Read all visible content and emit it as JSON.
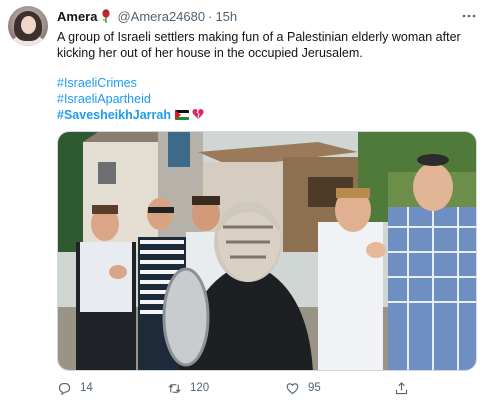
{
  "author": {
    "name": "Amera",
    "handle": "@Amera24680",
    "separator": "·",
    "time": "15h",
    "name_emoji_icon": "rose-icon"
  },
  "tweet": {
    "text": "A group of Israeli settlers making fun of a Palestinian elderly woman after kicking her out of her house in the occupied Jerusalem.",
    "hashtags": [
      "#IsraeliCrimes",
      "#IsraeliApartheid",
      "#SavesheikhJarrah"
    ],
    "trailing_icons": [
      "palestine-flag-icon",
      "broken-heart-icon"
    ],
    "image_alt_icon": "photo"
  },
  "actions": {
    "reply_count": "14",
    "retweet_count": "120",
    "like_count": "95"
  },
  "colors": {
    "link": "#1d9bf0",
    "muted": "#536471",
    "text": "#0f1419"
  }
}
